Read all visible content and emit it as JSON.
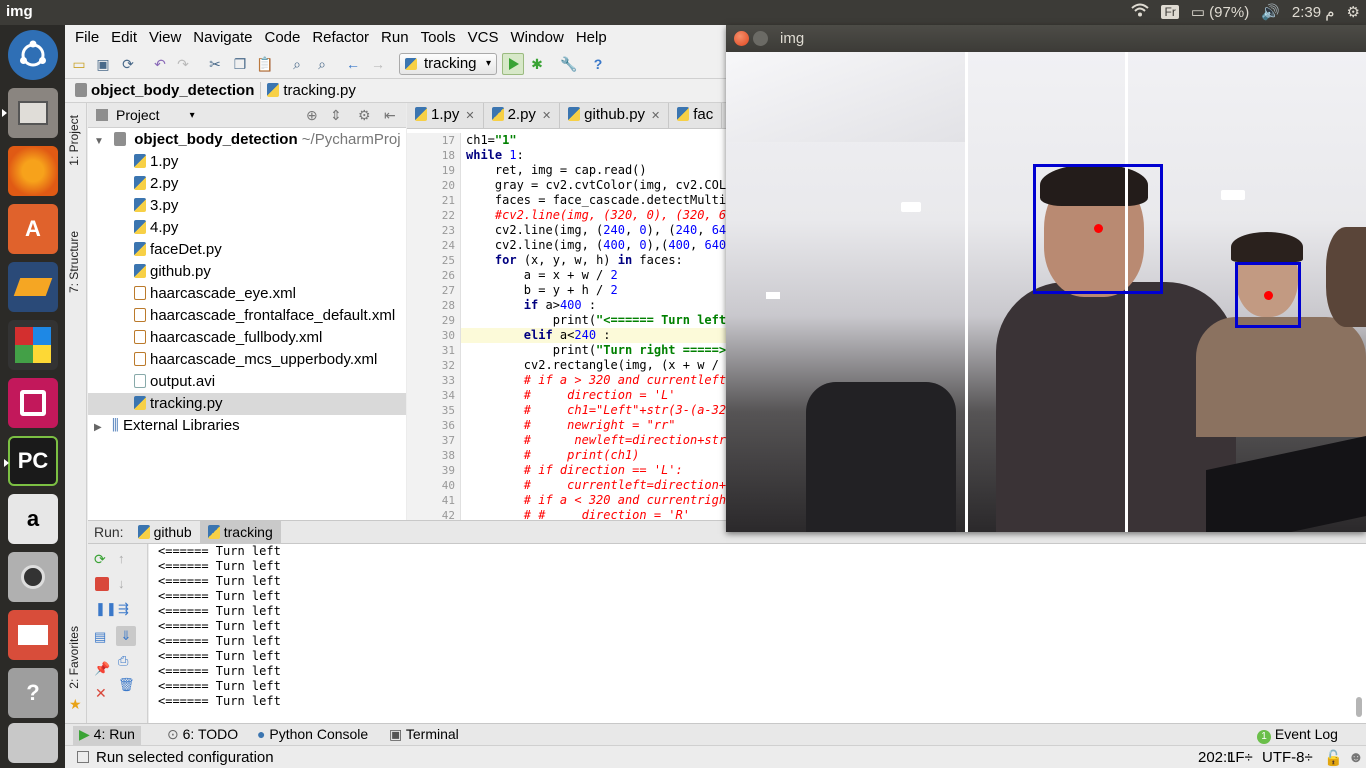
{
  "topbar": {
    "title": "img",
    "keyboard": "Fr",
    "battery": "(97%)",
    "clock": "2:39 م"
  },
  "launcher": {
    "items": [
      {
        "name": "ubuntu-dash-icon"
      },
      {
        "name": "files-icon"
      },
      {
        "name": "firefox-icon"
      },
      {
        "name": "software-center-icon"
      },
      {
        "name": "box-app-icon"
      },
      {
        "name": "libreoffice-icon"
      },
      {
        "name": "record-app-icon"
      },
      {
        "name": "pycharm-icon",
        "label": "PC"
      },
      {
        "name": "amazon-icon",
        "label": "a"
      },
      {
        "name": "camera-app-icon"
      },
      {
        "name": "presentation-app-icon"
      },
      {
        "name": "help-icon",
        "label": "?"
      },
      {
        "name": "scanner-icon"
      }
    ]
  },
  "menu": [
    "File",
    "Edit",
    "View",
    "Navigate",
    "Code",
    "Refactor",
    "Run",
    "Tools",
    "VCS",
    "Window",
    "Help"
  ],
  "toolbar": {
    "run_config": "tracking"
  },
  "navbar": {
    "project": "object_body_detection",
    "file": "tracking.py"
  },
  "sidestrip": {
    "project": "1: Project",
    "structure": "7: Structure",
    "favorites": "2: Favorites"
  },
  "project_panel": {
    "header": "Project",
    "root": "object_body_detection",
    "root_path": "~/PycharmProj",
    "files": [
      "1.py",
      "2.py",
      "3.py",
      "4.py",
      "faceDet.py",
      "github.py",
      "haarcascade_eye.xml",
      "haarcascade_frontalface_default.xml",
      "haarcascade_fullbody.xml",
      "haarcascade_mcs_upperbody.xml",
      "output.avi",
      "tracking.py"
    ],
    "external": "External Libraries"
  },
  "editor": {
    "tabs": [
      "1.py",
      "2.py",
      "github.py",
      "fac"
    ],
    "line_numbers": [
      "17",
      "18",
      "19",
      "20",
      "21",
      "22",
      "23",
      "24",
      "25",
      "26",
      "27",
      "28",
      "29",
      "30",
      "31",
      "32",
      "33",
      "34",
      "35",
      "36",
      "37",
      "38",
      "39",
      "40",
      "41",
      "42"
    ]
  },
  "run_panel": {
    "label": "Run:",
    "tabs": [
      "github",
      "tracking"
    ],
    "output_line": "<====== Turn left",
    "output_count": 11
  },
  "bottom": {
    "run": "4: Run",
    "todo": "6: TODO",
    "python_console": "Python Console",
    "terminal": "Terminal",
    "event_log": "Event Log",
    "event_count": "1"
  },
  "status": {
    "message": "Run selected configuration",
    "position": "202:1",
    "line_sep": "LF÷",
    "encoding": "UTF-8÷"
  },
  "img_window": {
    "title": "img"
  }
}
